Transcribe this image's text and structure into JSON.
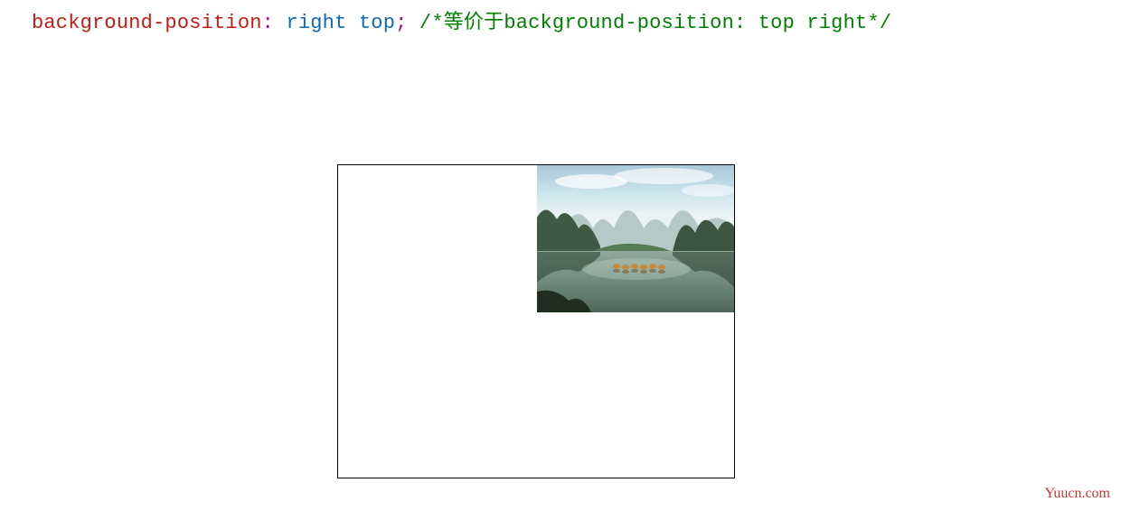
{
  "code": {
    "property": "background-position",
    "colon": ":",
    "value1": "right",
    "value2": "top",
    "semicolon": ";",
    "comment": "/*等价于background-position: top right*/"
  },
  "watermark": "Yuucn.com"
}
